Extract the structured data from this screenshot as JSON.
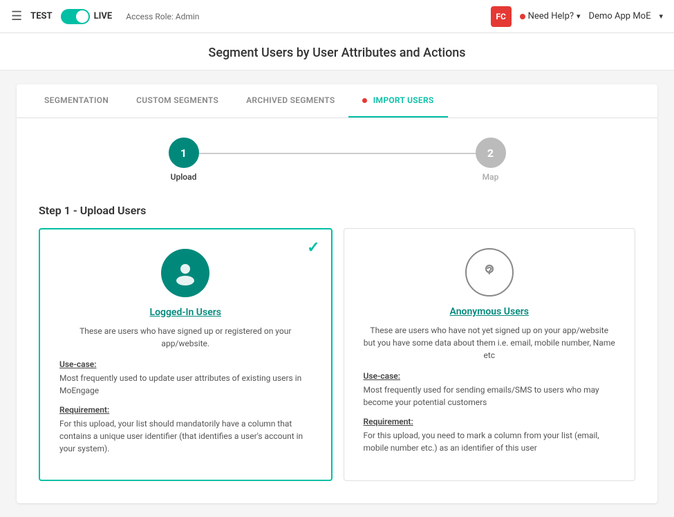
{
  "topnav": {
    "hamburger": "≡",
    "env": "TEST",
    "live": "LIVE",
    "access_role": "Access Role: Admin",
    "fc_badge": "FC",
    "need_help": "Need Help?",
    "demo_app": "Demo App MoE"
  },
  "page": {
    "title": "Segment Users by User Attributes and Actions"
  },
  "tabs": [
    {
      "id": "segmentation",
      "label": "SEGMENTATION",
      "active": false
    },
    {
      "id": "custom-segments",
      "label": "CUSTOM SEGMENTS",
      "active": false
    },
    {
      "id": "archived-segments",
      "label": "ARCHIVED SEGMENTS",
      "active": false
    },
    {
      "id": "import-users",
      "label": "IMPORT USERS",
      "active": true,
      "dot": true
    }
  ],
  "stepper": {
    "step1": {
      "number": "1",
      "label": "Upload",
      "active": true
    },
    "step2": {
      "number": "2",
      "label": "Map",
      "active": false
    }
  },
  "section_title": "Step 1 - Upload Users",
  "cards": [
    {
      "id": "logged-in",
      "selected": true,
      "title": "Logged-In Users",
      "description": "These are users who have signed up or registered on your app/website.",
      "use_case_label": "Use-case:",
      "use_case_text": "Most frequently used to update user attributes of existing users in MoEngage",
      "requirement_label": "Requirement:",
      "requirement_text": "For this upload, your list should mandatorily have a column that contains a unique user identifier (that identifies a user's account in your system)."
    },
    {
      "id": "anonymous",
      "selected": false,
      "title": "Anonymous Users",
      "description": "These are users who have not yet signed up on your app/website but you have some data about them i.e. email, mobile number, Name etc",
      "use_case_label": "Use-case:",
      "use_case_text": "Most frequently used for sending emails/SMS to users who may become your potential customers",
      "requirement_label": "Requirement:",
      "requirement_text": "For this upload, you need to mark a column from your list (email, mobile number etc.) as an identifier of this user"
    }
  ]
}
